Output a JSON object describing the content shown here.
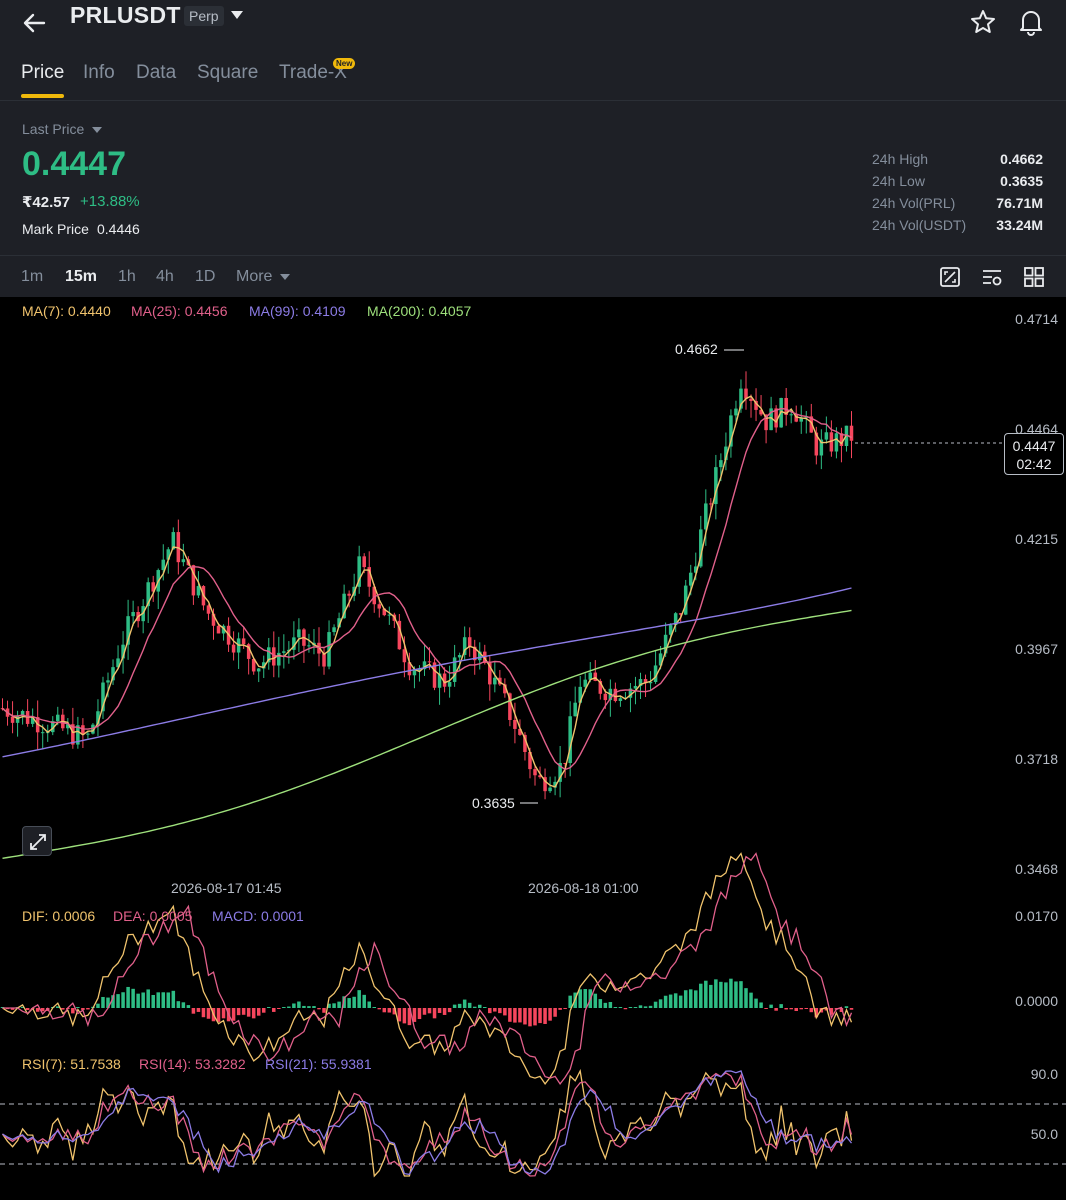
{
  "header": {
    "symbol": "PRLUSDT",
    "contract_type": "Perp",
    "icons": [
      "back-arrow-icon",
      "chevron-down-icon",
      "star-icon",
      "bell-icon"
    ]
  },
  "tabs": [
    {
      "label": "Price",
      "active": true
    },
    {
      "label": "Info",
      "active": false
    },
    {
      "label": "Data",
      "active": false
    },
    {
      "label": "Square",
      "active": false
    },
    {
      "label": "Trade-X",
      "active": false,
      "badge": "New"
    }
  ],
  "price_panel": {
    "last_price_label": "Last Price",
    "last_price": "0.4447",
    "inr_price": "₹42.57",
    "change_pct": "+13.88%",
    "mark_price_label": "Mark Price",
    "mark_price": "0.4446",
    "stats": [
      {
        "label": "24h High",
        "value": "0.4662"
      },
      {
        "label": "24h Low",
        "value": "0.3635"
      },
      {
        "label": "24h Vol(PRL)",
        "value": "76.71M"
      },
      {
        "label": "24h Vol(USDT)",
        "value": "33.24M"
      }
    ]
  },
  "intervals": [
    {
      "label": "1m",
      "active": false
    },
    {
      "label": "15m",
      "active": true
    },
    {
      "label": "1h",
      "active": false
    },
    {
      "label": "4h",
      "active": false
    },
    {
      "label": "1D",
      "active": false
    },
    {
      "label": "More",
      "active": false
    }
  ],
  "chart_tools": [
    "chart-compare-icon",
    "chart-settings-icon",
    "grid-layout-icon"
  ],
  "colors": {
    "up": "#2ebd85",
    "down": "#f6465d",
    "accent": "#f0b90b",
    "ma7": "#f0c36d",
    "ma25": "#e1608b",
    "ma99": "#8c7ce6",
    "ma200": "#9ee07c"
  },
  "chart_data": {
    "type": "candlestick",
    "interval": "15m",
    "price_axis": [
      "0.4714",
      "0.4464",
      "0.4215",
      "0.3967",
      "0.3718",
      "0.3468"
    ],
    "ylim": [
      0.3468,
      0.4714
    ],
    "date_labels": [
      "2026-08-17 01:45",
      "2026-08-18 01:00"
    ],
    "high_marker": "0.4662",
    "low_marker": "0.3635",
    "current_price": "0.4447",
    "countdown": "02:42",
    "moving_averages": [
      {
        "name": "MA(7)",
        "value": "0.4440"
      },
      {
        "name": "MA(25)",
        "value": "0.4456"
      },
      {
        "name": "MA(99)",
        "value": "0.4109"
      },
      {
        "name": "MA(200)",
        "value": "0.4057"
      }
    ],
    "macd": {
      "dif": "0.0006",
      "dea": "0.0005",
      "macd": "0.0001",
      "axis": [
        "0.0170",
        "0.0000"
      ]
    },
    "rsi": {
      "rsi7": "51.7538",
      "rsi14": "53.3282",
      "rsi21": "55.9381",
      "axis": [
        "90.0",
        "50.0"
      ]
    }
  }
}
